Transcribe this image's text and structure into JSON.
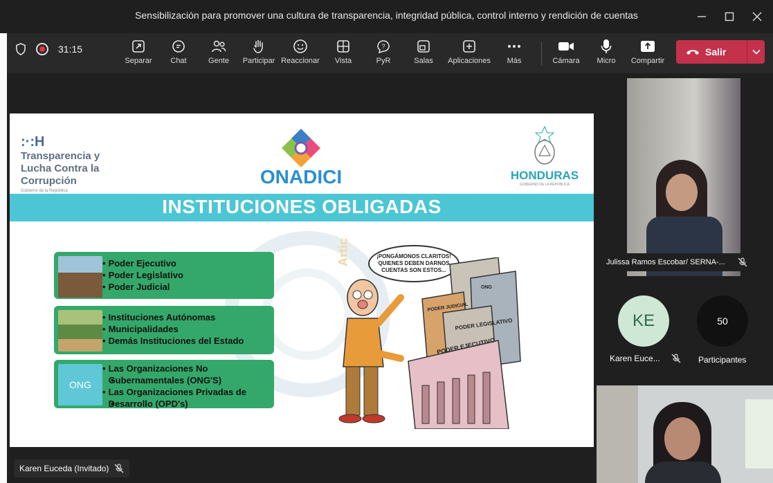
{
  "window": {
    "title": "Sensibilización para promover una cultura de transparencia, integridad pública, control interno y rendición de cuentas"
  },
  "toolbar": {
    "timer": "31:15",
    "buttons": [
      {
        "label": "Separar",
        "icon": "pop-out-icon"
      },
      {
        "label": "Chat",
        "icon": "chat-icon"
      },
      {
        "label": "Gente",
        "icon": "people-icon"
      },
      {
        "label": "Participar",
        "icon": "raise-hand-icon"
      },
      {
        "label": "Reaccionar",
        "icon": "smiley-icon"
      },
      {
        "label": "Vista",
        "icon": "grid-view-icon"
      },
      {
        "label": "PyR",
        "icon": "qa-icon"
      },
      {
        "label": "Salas",
        "icon": "rooms-icon"
      },
      {
        "label": "Aplicaciones",
        "icon": "plus-square-icon"
      },
      {
        "label": "Más",
        "icon": "more-icon"
      }
    ],
    "media": [
      {
        "label": "Cámara",
        "icon": "camera-icon"
      },
      {
        "label": "Micro",
        "icon": "mic-icon"
      },
      {
        "label": "Compartir",
        "icon": "share-icon"
      }
    ],
    "leave_label": "Salir"
  },
  "slide": {
    "tlc_logo": ":·:H",
    "tlc_lines": [
      "Transparencia y",
      "Lucha Contra la",
      "Corrupción"
    ],
    "tlc_small": "Gobierno de la República",
    "onadici": "ONADICI",
    "honduras": "HONDURAS",
    "honduras_sub": "GOBIERNO DE LA REPÚBLICA",
    "title": "INSTITUCIONES OBLIGADAS",
    "box1": [
      "Poder Ejecutivo",
      "Poder Legislativo",
      "Poder Judicial"
    ],
    "box2": [
      "Instituciones Autónomas",
      "Municipalidades",
      "Demás Instituciones del Estado"
    ],
    "box3": [
      "Las Organizaciones No",
      "Gubernamentales (ONG'S)",
      "Las Organizaciones Privadas de",
      "Desarrollo (OPD's)"
    ],
    "ong_logo": "ONG",
    "bubble": "¡PONGÁMONOS CLARITOS! QUIENES DEBEN DARNOS CUENTAS SON ESTOS...",
    "building_labels": [
      "PODER JUDICIAL",
      "PODER LEGISLATIVO",
      "PODER EJECUTIVO",
      "ONG"
    ],
    "watermark": "Artic"
  },
  "presenter_name": "Karen Euceda (Invitado)",
  "participants": {
    "tile1_name": "Julissa Ramos Escobar/ SERNA-...",
    "ke_initials": "KE",
    "ke_name": "Karen Euce...",
    "count": "50",
    "count_label": "Participantes"
  },
  "colors": {
    "leave": "#c4314b",
    "banner": "#4cc6d4",
    "box_green": "#34a86a"
  }
}
